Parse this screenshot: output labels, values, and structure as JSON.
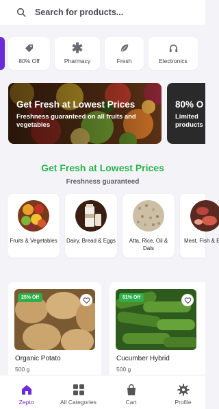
{
  "search": {
    "placeholder": "Search for products..."
  },
  "categories": [
    {
      "label": "80% Off",
      "icon": "tag-icon"
    },
    {
      "label": "Pharmacy",
      "icon": "asterisk-icon"
    },
    {
      "label": "Fresh",
      "icon": "leaf-icon"
    },
    {
      "label": "Electronics",
      "icon": "headphones-icon"
    }
  ],
  "banners": [
    {
      "title": "Get Fresh at Lowest Prices",
      "subtitle": "Freshness guaranteed on all fruits and vegetables"
    },
    {
      "title": "80% O",
      "subtitle": "Limited products"
    }
  ],
  "section": {
    "title": "Get Fresh at Lowest Prices",
    "subtitle": "Freshness guaranteed"
  },
  "tiles": [
    {
      "label": "Fruits & Vegetables"
    },
    {
      "label": "Dairy, Bread & Eggs"
    },
    {
      "label": "Atta, Rice, Oil & Dals"
    },
    {
      "label": "Meat, Fish & Eg"
    }
  ],
  "products": [
    {
      "name": "Organic Potato",
      "qty": "500 g",
      "discount": "25% Off"
    },
    {
      "name": "Cucumber Hybrid",
      "qty": "500 g",
      "discount": "51% Off"
    }
  ],
  "nav": [
    {
      "label": "Zepto",
      "icon": "home-icon",
      "active": true
    },
    {
      "label": "All Categories",
      "icon": "grid-icon",
      "active": false
    },
    {
      "label": "Cart",
      "icon": "shopping-bag-icon",
      "active": false
    },
    {
      "label": "Profile",
      "icon": "settings-icon",
      "active": false
    }
  ],
  "colors": {
    "accent": "#6c2bd9",
    "green": "#27b34a",
    "badge": "#2fae49"
  }
}
